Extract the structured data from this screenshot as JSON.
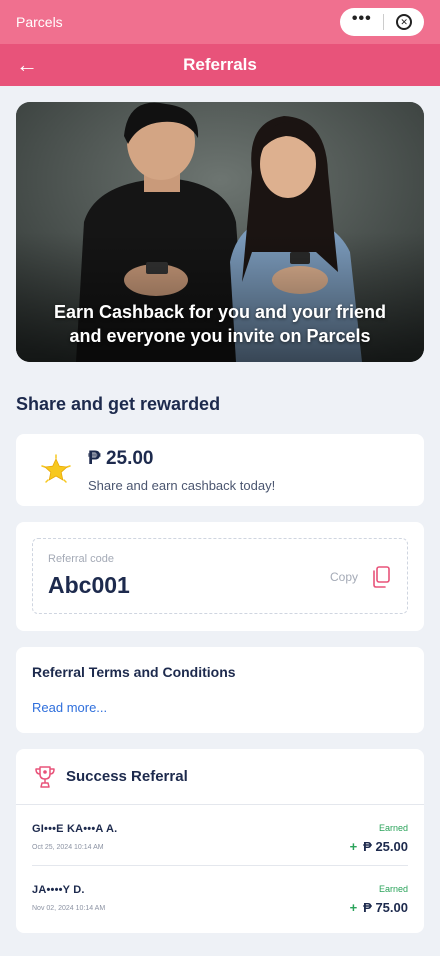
{
  "topbar": {
    "app_name": "Parcels",
    "more_glyph": "•••",
    "close_glyph": "✕"
  },
  "navbar": {
    "back_glyph": "←",
    "title": "Referrals"
  },
  "hero": {
    "caption": "Earn Cashback for you and your friend and everyone you invite on Parcels"
  },
  "share": {
    "section_title": "Share and get rewarded",
    "amount": "₱ 25.00",
    "subtitle": "Share and earn cashback today!"
  },
  "referral_code": {
    "label": "Referral code",
    "value": "Abc001",
    "copy_label": "Copy"
  },
  "terms": {
    "title": "Referral Terms and Conditions",
    "link": "Read more..."
  },
  "success": {
    "title": "Success Referral",
    "items": [
      {
        "name": "GI•••E KA•••A A.",
        "date": "Oct 25, 2024  10:14 AM",
        "earned_label": "Earned",
        "plus": "+",
        "amount": "₱ 25.00"
      },
      {
        "name": "JA••••Y D.",
        "date": "Nov 02, 2024  10:14 AM",
        "earned_label": "Earned",
        "plus": "+",
        "amount": "₱ 75.00"
      }
    ]
  },
  "colors": {
    "topbar": "#f0708f",
    "navbar": "#e8537a",
    "accent_green": "#2aa35a",
    "link_blue": "#2f6fdc",
    "navy": "#1d2a4d",
    "star": "#f7c81e",
    "pink_icon": "#e8537a"
  },
  "icons": {
    "star": "star-icon",
    "copy": "copy-icon",
    "trophy": "trophy-icon",
    "back": "arrow-left-icon",
    "more": "more-dots-icon",
    "close": "close-circle-icon"
  }
}
